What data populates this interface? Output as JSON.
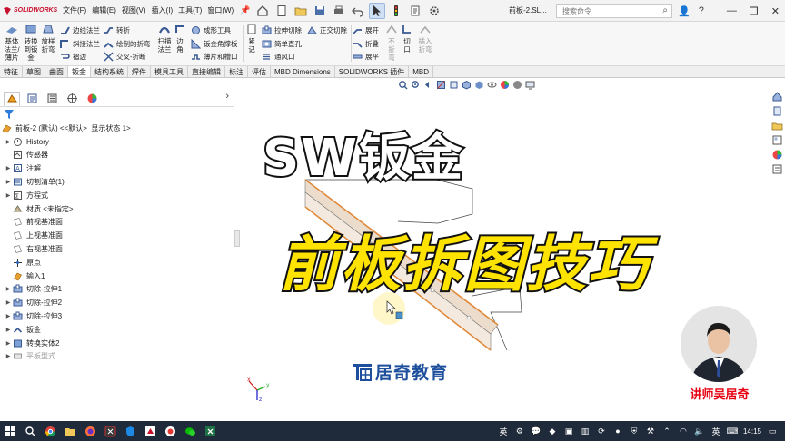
{
  "app": {
    "logo_text": "SOLIDWORKS",
    "document_title": "前板-2.SL..."
  },
  "menu": [
    "文件(F)",
    "编辑(E)",
    "视图(V)",
    "插入(I)",
    "工具(T)",
    "窗口(W)"
  ],
  "search": {
    "placeholder": "搜索命令"
  },
  "ribbon": {
    "big": [
      {
        "label1": "基体",
        "label2": "法兰/",
        "label3": "薄片",
        "icon": "base-flange-icon"
      },
      {
        "label1": "转换",
        "label2": "到钣",
        "label3": "金",
        "icon": "convert-to-sheet-metal-icon"
      },
      {
        "label1": "放样",
        "label2": "折弯",
        "label3": "",
        "icon": "lofted-bend-icon"
      },
      {
        "label1": "扫描",
        "label2": "法兰",
        "label3": "",
        "icon": "swept-flange-icon"
      },
      {
        "label1": "边",
        "label2": "角",
        "label3": "",
        "icon": "corners-icon"
      },
      {
        "label1": "展",
        "label2": "开",
        "label3": "",
        "icon": "unfold-big-icon"
      },
      {
        "label1": "不",
        "label2": "折",
        "label3": "弯",
        "icon": "no-bends-icon"
      },
      {
        "label1": "切",
        "label2": "口",
        "label3": "",
        "icon": "rip-icon"
      },
      {
        "label1": "插入",
        "label2": "折弯",
        "label3": "",
        "icon": "insert-bends-icon"
      }
    ],
    "small": {
      "edge_flange": "边线法兰",
      "miter_flange": "斜接法兰",
      "hem": "褶边",
      "jog": "转折",
      "sketched_bend": "绘制的折弯",
      "cross_break": "交叉-折断",
      "forming_tool": "成形工具",
      "corner_gusset": "钣金角撑板",
      "tab_slot": "薄片和槽口",
      "extruded_cut": "拉伸切除",
      "simple_hole": "简单直孔",
      "vent": "通风口",
      "normal_cut": "正交切除",
      "unfold": "展开",
      "fold": "折叠",
      "flatten": "展平"
    }
  },
  "tabs": [
    "特征",
    "草图",
    "曲面",
    "钣金",
    "结构系统",
    "焊件",
    "模具工具",
    "直接编辑",
    "标注",
    "评估",
    "MBD Dimensions",
    "SOLIDWORKS 插件",
    "MBD"
  ],
  "active_tab_index": 3,
  "tree": {
    "root": "前板-2 (默认) <<默认>_显示状态 1>",
    "items": [
      {
        "label": "History",
        "icon": "history-icon",
        "expand": true,
        "dim": false
      },
      {
        "label": "传感器",
        "icon": "sensor-icon",
        "expand": false,
        "dim": false
      },
      {
        "label": "注解",
        "icon": "annotations-icon",
        "expand": true,
        "dim": false
      },
      {
        "label": "切割清单(1)",
        "icon": "cut-list-icon",
        "expand": true,
        "dim": false
      },
      {
        "label": "方程式",
        "icon": "equations-icon",
        "expand": true,
        "dim": false
      },
      {
        "label": "材质 <未指定>",
        "icon": "material-icon",
        "expand": false,
        "dim": false
      },
      {
        "label": "前视基准面",
        "icon": "plane-icon",
        "expand": false,
        "dim": false
      },
      {
        "label": "上视基准面",
        "icon": "plane-icon",
        "expand": false,
        "dim": false
      },
      {
        "label": "右视基准面",
        "icon": "plane-icon",
        "expand": false,
        "dim": false
      },
      {
        "label": "原点",
        "icon": "origin-icon",
        "expand": false,
        "dim": false
      },
      {
        "label": "输入1",
        "icon": "imported-body-icon",
        "expand": false,
        "dim": false
      },
      {
        "label": "切除-拉伸1",
        "icon": "extruded-cut-icon",
        "expand": true,
        "dim": false
      },
      {
        "label": "切除-拉伸2",
        "icon": "extruded-cut-icon",
        "expand": true,
        "dim": false
      },
      {
        "label": "切除-拉伸3",
        "icon": "extruded-cut-icon",
        "expand": true,
        "dim": false
      },
      {
        "label": "钣金",
        "icon": "sheet-metal-icon",
        "expand": true,
        "dim": false
      },
      {
        "label": "转换实体2",
        "icon": "convert-entity-icon",
        "expand": true,
        "dim": false
      },
      {
        "label": "平板型式",
        "icon": "flat-pattern-icon",
        "expand": true,
        "dim": true
      }
    ]
  },
  "overlay": {
    "title_line1": "SW钣金",
    "title_line2": "前板拆图技巧",
    "brand": "居奇教育",
    "lecturer": "讲师吴居奇"
  },
  "taskbar": {
    "apps": [
      "windows-start-icon",
      "search-icon",
      "chrome-icon",
      "folder-icon",
      "firefox-icon",
      "media-icon",
      "antivirus-icon",
      "solidworks-icon",
      "recorder-icon",
      "wechat-icon",
      "excel-icon"
    ],
    "tray_ime_1": "英",
    "tray_ime_2": "英",
    "clock": "14:15"
  },
  "colors": {
    "title_white": "#ffffff",
    "title_yellow": "#ffe300",
    "brand_blue": "#1d4f9c",
    "lecturer_red": "#e60012",
    "part_orange": "#e08a3c",
    "part_face": "#ecdccb",
    "taskbar_bg": "#1f2a3a"
  }
}
